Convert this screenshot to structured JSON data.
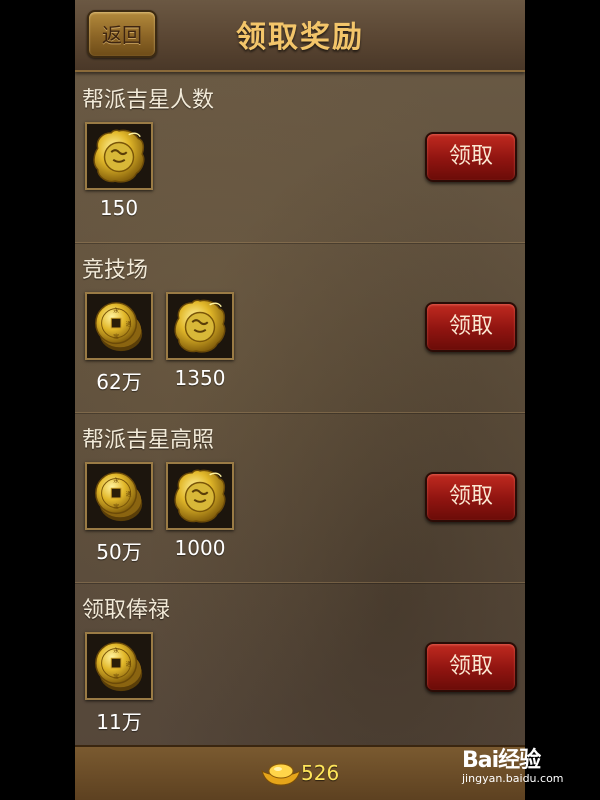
{
  "header": {
    "back_label": "返回",
    "title": "领取奖励"
  },
  "sections": [
    {
      "title": "帮派吉星人数",
      "button_label": "领取",
      "items": [
        {
          "icon": "dragon-seal-icon",
          "label": "150"
        }
      ]
    },
    {
      "title": "竞技场",
      "button_label": "领取",
      "items": [
        {
          "icon": "copper-coins-icon",
          "label": "62万"
        },
        {
          "icon": "dragon-seal-icon",
          "label": "1350"
        }
      ]
    },
    {
      "title": "帮派吉星高照",
      "button_label": "领取",
      "items": [
        {
          "icon": "copper-coins-icon",
          "label": "50万"
        },
        {
          "icon": "dragon-seal-icon",
          "label": "1000"
        }
      ]
    },
    {
      "title": "领取俸禄",
      "button_label": "领取",
      "items": [
        {
          "icon": "copper-coins-icon",
          "label": "11万"
        }
      ]
    }
  ],
  "footer": {
    "currency_icon": "gold-ingot-icon",
    "gold_amount": "526"
  },
  "watermark": {
    "brand": "Bai经验",
    "brand_suffix": "经验",
    "url": "jingyan.baidu.com"
  },
  "colors": {
    "title": "#f3c56a",
    "claim_button": "#a81c14",
    "gold_text": "#ffe65a"
  }
}
